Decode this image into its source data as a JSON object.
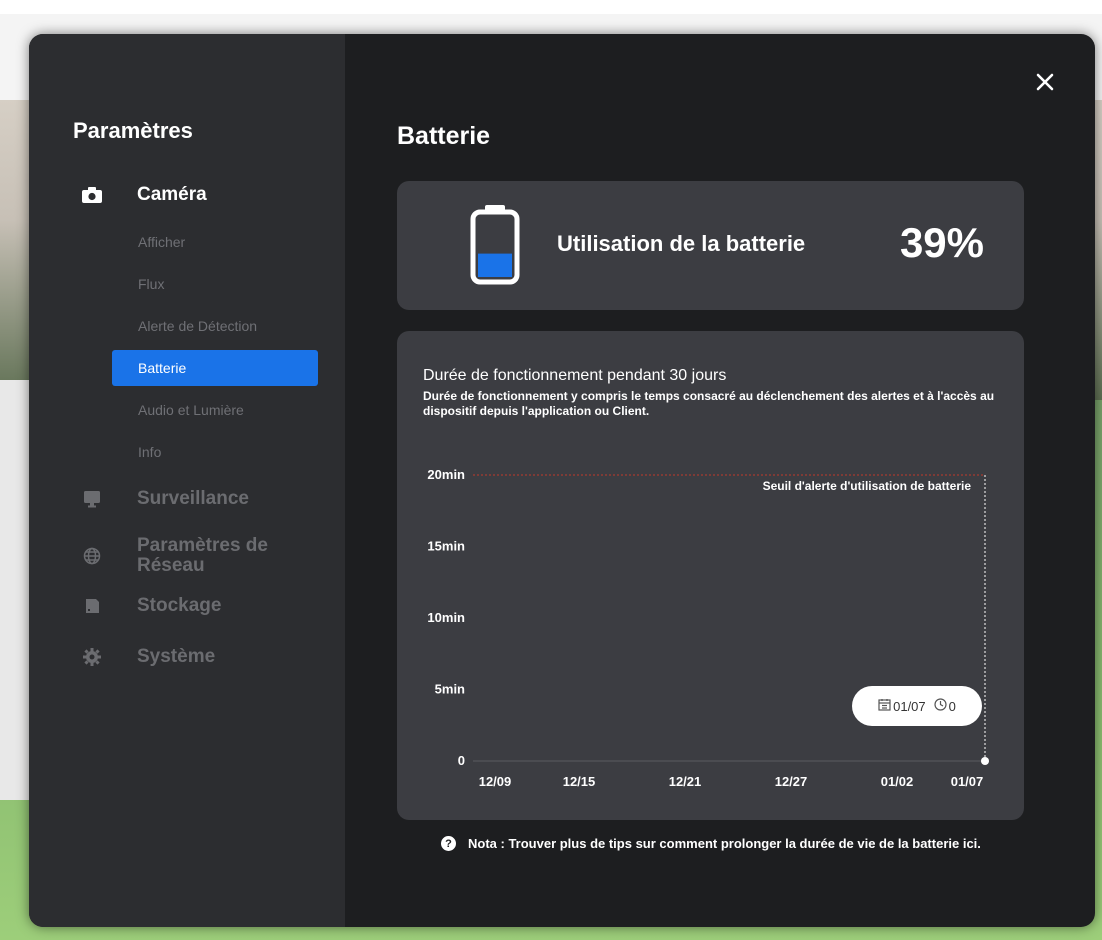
{
  "colors": {
    "accent": "#1a73e8",
    "panel": "#3c3d42",
    "sidebar": "#2c2d30",
    "modal": "#1d1e20",
    "threshold": "#c0392b"
  },
  "sidebar": {
    "title": "Paramètres",
    "camera": {
      "label": "Caméra",
      "icon": "camera-icon",
      "items": [
        "Afficher",
        "Flux",
        "Alerte de Détection",
        "Batterie",
        "Audio et Lumière",
        "Info"
      ],
      "selected": "Batterie"
    },
    "categories": [
      {
        "label": "Surveillance",
        "icon": "monitor-icon"
      },
      {
        "label": "Paramètres de Réseau",
        "icon": "globe-icon"
      },
      {
        "label": "Stockage",
        "icon": "storage-icon"
      },
      {
        "label": "Système",
        "icon": "gear-icon"
      }
    ]
  },
  "main": {
    "title": "Batterie",
    "close_icon": "close-icon",
    "battery": {
      "label": "Utilisation de la batterie",
      "value": "39%",
      "level": 0.39,
      "icon": "battery-icon"
    },
    "chart": {
      "title": "Durée de fonctionnement pendant 30 jours",
      "description": "Durée de fonctionnement y compris le temps consacré au déclenchement des alertes et à l'accès au dispositif depuis l'application ou Client.",
      "threshold_label": "Seuil d'alerte d'utilisation de batterie",
      "tooltip": {
        "date": "01/07",
        "value": "0",
        "calendar_icon": "calendar-icon",
        "clock_icon": "clock-icon"
      }
    },
    "note": "Nota : Trouver plus de tips sur comment prolonger la durée de vie de la batterie ici."
  },
  "chart_data": {
    "type": "line",
    "title": "Durée de fonctionnement pendant 30 jours",
    "xlabel": "",
    "ylabel": "",
    "x_ticks": [
      "12/09",
      "12/15",
      "12/21",
      "12/27",
      "01/02",
      "01/07"
    ],
    "y_ticks": [
      "0",
      "5min",
      "10min",
      "15min",
      "20min"
    ],
    "ylim": [
      0,
      20
    ],
    "threshold": 20,
    "threshold_label": "Seuil d'alerte d'utilisation de batterie",
    "series": [
      {
        "x": [
          "01/07"
        ],
        "values": [
          0
        ]
      }
    ],
    "grid": false,
    "legend": "none"
  }
}
